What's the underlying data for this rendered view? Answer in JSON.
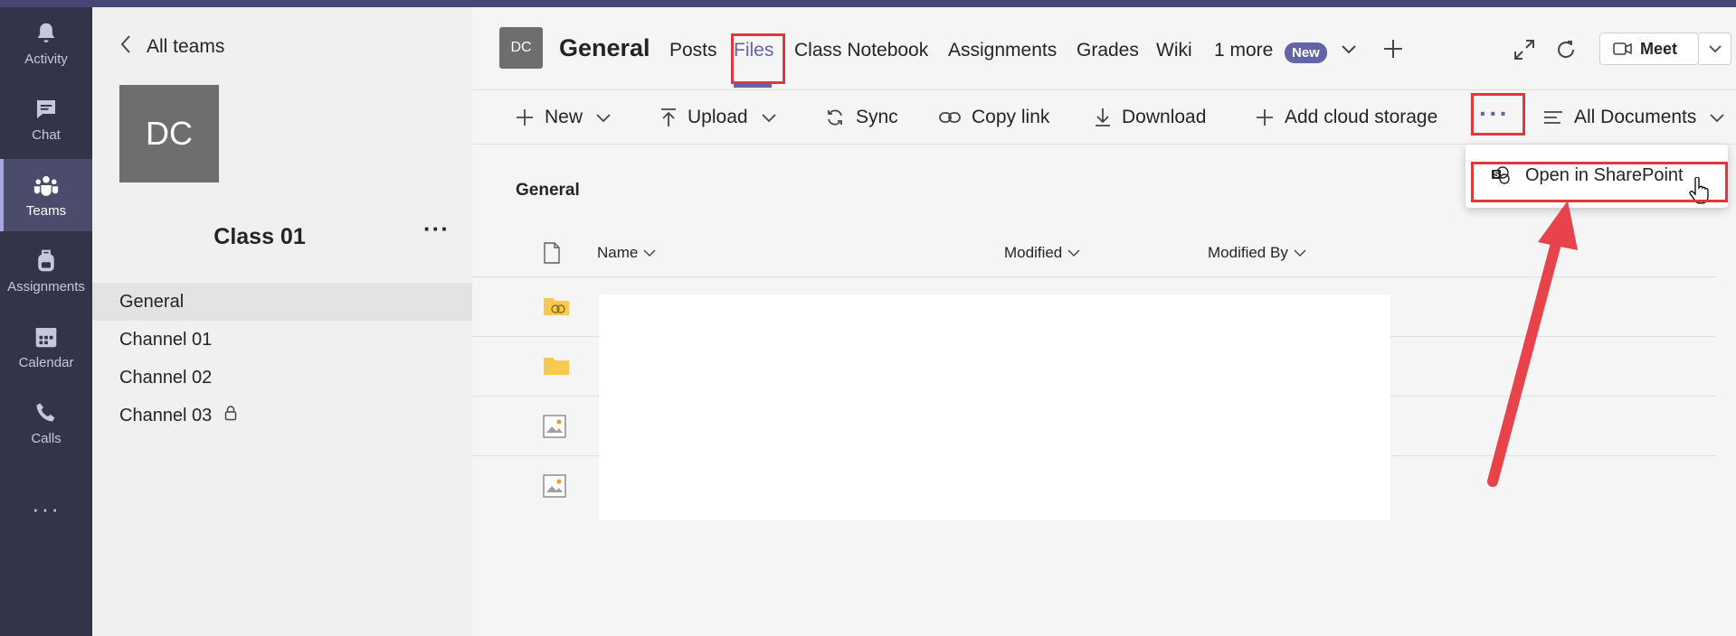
{
  "rail": {
    "items": [
      {
        "label": "Activity",
        "icon": "bell-icon"
      },
      {
        "label": "Chat",
        "icon": "chat-icon"
      },
      {
        "label": "Teams",
        "icon": "teams-icon"
      },
      {
        "label": "Assignments",
        "icon": "backpack-icon"
      },
      {
        "label": "Calendar",
        "icon": "calendar-icon"
      },
      {
        "label": "Calls",
        "icon": "phone-icon"
      }
    ],
    "more": "···",
    "active": "Teams"
  },
  "team_panel": {
    "back_label": "All teams",
    "avatar_initials": "DC",
    "team_name": "Class 01",
    "more": "···",
    "channels": [
      {
        "label": "General",
        "active": true
      },
      {
        "label": "Channel 01"
      },
      {
        "label": "Channel 02"
      },
      {
        "label": "Channel 03",
        "locked": true
      }
    ]
  },
  "header": {
    "avatar_initials": "DC",
    "title": "General",
    "tabs": [
      "Posts",
      "Files",
      "Class Notebook",
      "Assignments",
      "Grades",
      "Wiki",
      "1 more"
    ],
    "active_tab": "Files",
    "new_badge": "New",
    "meet_label": "Meet"
  },
  "toolbar": {
    "new": "New",
    "upload": "Upload",
    "sync": "Sync",
    "copy_link": "Copy link",
    "download": "Download",
    "add_cloud": "Add cloud storage",
    "more": "···",
    "view": "All Documents"
  },
  "files": {
    "section_title": "General",
    "columns": {
      "name": "Name",
      "modified": "Modified",
      "modified_by": "Modified By"
    },
    "rows": [
      {
        "icon": "shared-folder-icon"
      },
      {
        "icon": "folder-icon"
      },
      {
        "icon": "image-file-icon"
      },
      {
        "icon": "image-file-icon"
      }
    ]
  },
  "menu": {
    "item": "Open in SharePoint"
  },
  "colors": {
    "accent": "#6264a7",
    "rail": "#33344a",
    "annotation": "#e0363c"
  }
}
